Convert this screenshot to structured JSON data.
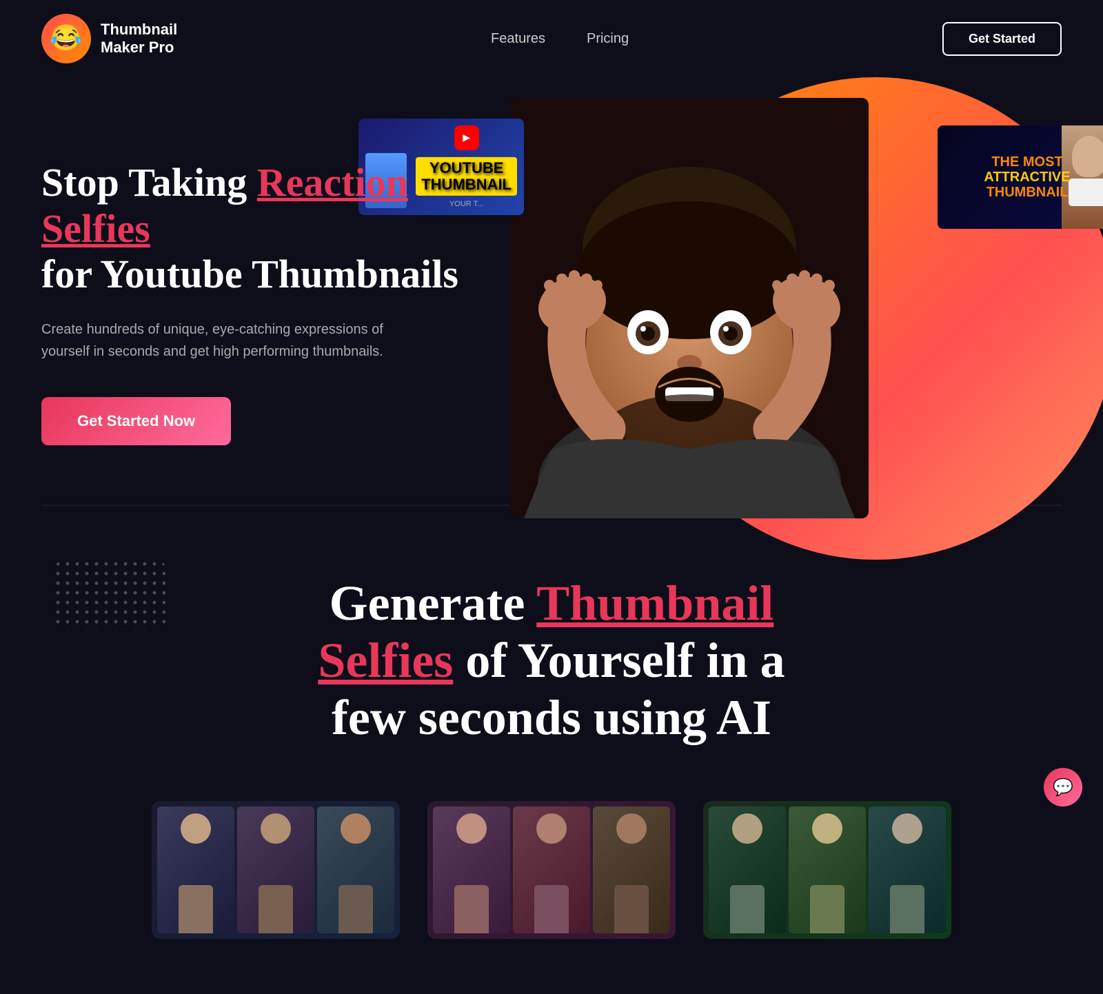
{
  "app": {
    "name": "Thumbnail Maker Pro",
    "logo_emoji": "😂"
  },
  "nav": {
    "logo_text_line1": "Thumbnail",
    "logo_text_line2": "Maker Pro",
    "links": [
      {
        "label": "Features",
        "id": "features"
      },
      {
        "label": "Pricing",
        "id": "pricing"
      }
    ],
    "cta_label": "Get Started"
  },
  "hero": {
    "headline_plain": "Stop Taking ",
    "headline_highlight": "Reaction Selfies",
    "headline_rest": " for Youtube Thumbnails",
    "subtitle": "Create hundreds of unique, eye-catching expressions of yourself in seconds and get high performing thumbnails.",
    "cta_label": "Get Started Now",
    "yt_label_1": "YOUTUBE THUMBNAIL",
    "yt_label_2": "THE MOST ATTRACTIVE THUMBNAIL"
  },
  "generate_section": {
    "headline_plain1": "Generate ",
    "headline_highlight": "Thumbnail Selfies",
    "headline_plain2": " of Yourself in a few seconds using AI"
  },
  "chat": {
    "icon": "💬"
  }
}
